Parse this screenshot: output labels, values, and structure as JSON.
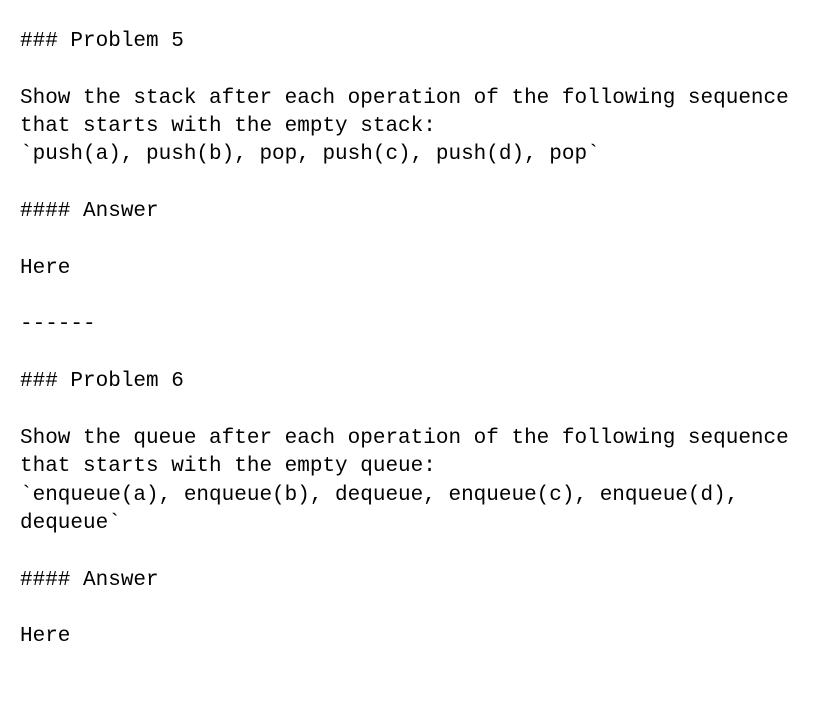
{
  "problem5": {
    "heading": "### Problem 5",
    "prompt_text": "Show the stack after each operation of the following sequence that starts with the empty stack:",
    "code": "`push(a), push(b), pop, push(c), push(d), pop`",
    "answer_heading": "#### Answer",
    "answer_body": "Here"
  },
  "separator": "------",
  "problem6": {
    "heading": "### Problem 6",
    "prompt_text": "Show the queue after each operation of the following sequence that starts with the empty queue:",
    "code": "`enqueue(a), enqueue(b), dequeue, enqueue(c), enqueue(d), dequeue`",
    "answer_heading": "#### Answer",
    "answer_body": "Here"
  }
}
